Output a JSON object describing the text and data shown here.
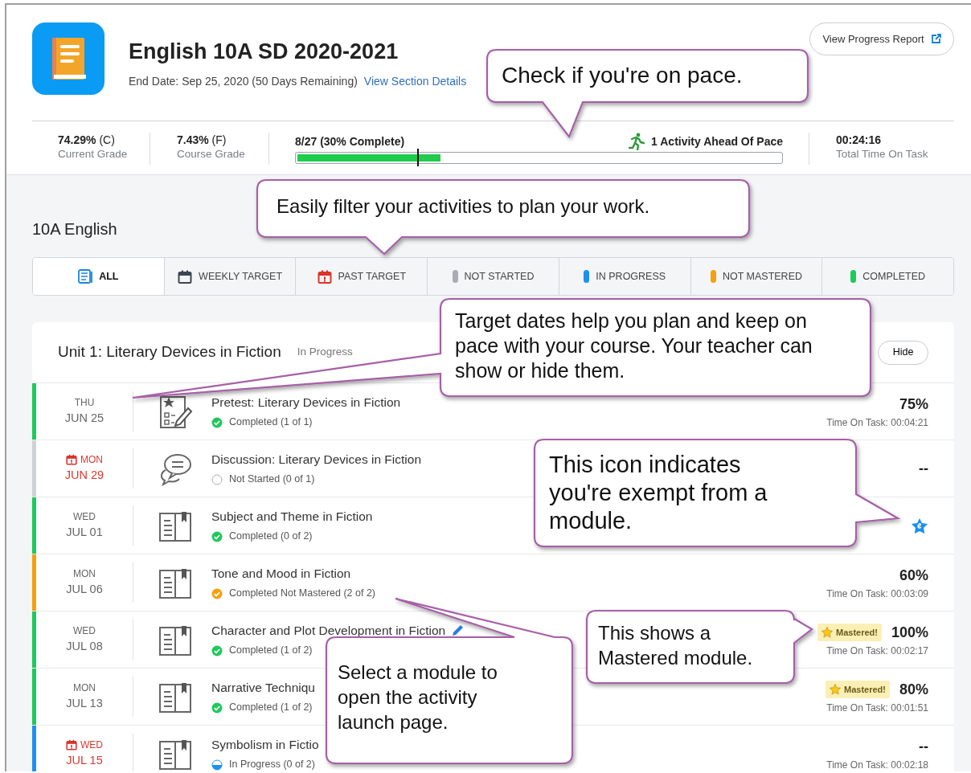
{
  "course": {
    "title": "English 10A SD 2020-2021",
    "end_date": "End Date: Sep 25, 2020 (50 Days Remaining)",
    "details_link": "View Section Details",
    "report_button": "View Progress Report"
  },
  "stats": [
    {
      "value": "74.29%",
      "grade": "(C)",
      "label": "Current Grade"
    },
    {
      "value": "7.43%",
      "grade": "(F)",
      "label": "Course Grade"
    }
  ],
  "progress": {
    "text": "8/27 (30% Complete)",
    "level": 0.3,
    "pace": "1 Activity Ahead Of Pace"
  },
  "pace_marker": {
    "level": 0.25
  },
  "time_on_task": {
    "value": "00:24:16",
    "label": "Total Time On Task"
  },
  "section_title": "10A English",
  "filters": [
    {
      "label": "ALL",
      "kind": "all",
      "selected": true
    },
    {
      "label": "WEEKLY TARGET",
      "kind": "weekly",
      "selected": false
    },
    {
      "label": "PAST TARGET",
      "kind": "past",
      "selected": false
    },
    {
      "label": "NOT STARTED",
      "kind": "status",
      "color": "#a9adb2",
      "selected": false
    },
    {
      "label": "IN PROGRESS",
      "kind": "status",
      "color": "#1e90f0",
      "selected": false
    },
    {
      "label": "NOT MASTERED",
      "kind": "status",
      "color": "#f5a00f",
      "selected": false
    },
    {
      "label": "COMPLETED",
      "kind": "status",
      "color": "#1ec95b",
      "selected": false
    }
  ],
  "unit": {
    "title": "Unit 1: Literary Devices in Fiction",
    "status": "In Progress",
    "hide_button": "Hide"
  },
  "rows": [
    {
      "day": "THU",
      "date": "JUN 25",
      "overdue": false,
      "color": "#1ec95b",
      "kind": "pretest",
      "title": "Pretest: Literary Devices in Fiction",
      "edited": false,
      "status": {
        "kind": "completed",
        "text": "Completed (1 of 1)"
      },
      "exempt": false,
      "score": "75%",
      "time": "Time On Task: 00:04:21"
    },
    {
      "day": "MON",
      "date": "JUN 29",
      "overdue": true,
      "color": "#cfd2d5",
      "kind": "discussion",
      "title": "Discussion: Literary Devices in Fiction",
      "edited": false,
      "status": {
        "kind": "not_started",
        "text": "Not Started (0 of 1)"
      },
      "exempt": false,
      "score": "--"
    },
    {
      "day": "WED",
      "date": "JUL 01",
      "overdue": false,
      "color": "#1ec95b",
      "kind": "lesson",
      "title": "Subject and Theme in Fiction",
      "edited": false,
      "status": {
        "kind": "completed",
        "text": "Completed (0 of 2)"
      },
      "exempt": true
    },
    {
      "day": "MON",
      "date": "JUL 06",
      "overdue": false,
      "color": "#f5a00f",
      "kind": "lesson",
      "title": "Tone and Mood in Fiction",
      "edited": false,
      "status": {
        "kind": "not_mastered",
        "text": "Completed Not Mastered (2 of 2)"
      },
      "exempt": false,
      "score": "60%",
      "time": "Time On Task: 00:03:09"
    },
    {
      "day": "WED",
      "date": "JUL 08",
      "overdue": false,
      "color": "#1ec95b",
      "kind": "lesson",
      "title": "Character and Plot Development in Fiction",
      "edited": true,
      "status": {
        "kind": "completed",
        "text": "Completed (1 of 2)"
      },
      "exempt": false,
      "badge": "Mastered!",
      "score": "100%",
      "time": "Time On Task: 00:02:17"
    },
    {
      "day": "MON",
      "date": "JUL 13",
      "overdue": false,
      "color": "#1ec95b",
      "kind": "lesson",
      "title": "Narrative Techniqu",
      "edited": false,
      "status": {
        "kind": "completed",
        "text": "Completed (1 of 2)"
      },
      "exempt": false,
      "badge": "Mastered!",
      "score": "80%",
      "time": "Time On Task: 00:01:51"
    },
    {
      "day": "WED",
      "date": "JUL 15",
      "overdue": true,
      "color": "#1e90f0",
      "kind": "lesson",
      "title": "Symbolism in Fictio",
      "edited": false,
      "status": {
        "kind": "in_progress",
        "text": "In Progress (0 of 2)"
      },
      "exempt": false,
      "score": "--",
      "time": "Time On Task: 00:02:18"
    }
  ],
  "callouts": [
    {
      "text": "Check if you're on pace."
    },
    {
      "text": "Easily filter your activities to plan your work."
    },
    {
      "text": "Target dates help you plan and keep on pace with your course. Your teacher can show or hide them."
    },
    {
      "text": "This icon indicates you're exempt from a module."
    },
    {
      "text": "This shows a Mastered module."
    },
    {
      "text": "Select a module to open the activity launch page."
    }
  ]
}
